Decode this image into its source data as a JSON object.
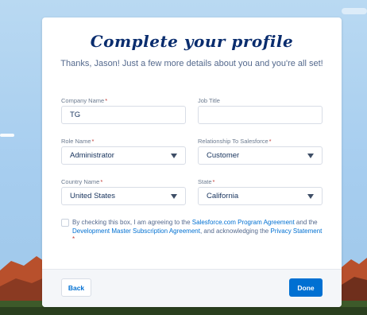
{
  "header": {
    "title": "Complete your profile",
    "subtitle": "Thanks, Jason! Just a few more details about you and you're all set!"
  },
  "form": {
    "company_name": {
      "label": "Company Name",
      "value": "TG",
      "required": "*"
    },
    "job_title": {
      "label": "Job Title",
      "value": ""
    },
    "role_name": {
      "label": "Role Name",
      "value": "Administrator",
      "required": "*"
    },
    "relationship": {
      "label": "Relationship To Salesforce",
      "value": "Customer",
      "required": "*"
    },
    "country_name": {
      "label": "Country Name",
      "value": "United States",
      "required": "*"
    },
    "state": {
      "label": "State",
      "value": "California",
      "required": "*"
    }
  },
  "agreement": {
    "text_1": "By checking this box, I am agreeing to the ",
    "link_1": "Salesforce.com Program Agreement",
    "text_2": " and the ",
    "link_2": "Development Master Subscription Agreement",
    "text_3": ", and acknowledging the ",
    "link_3": "Privacy Statement",
    "required": " *"
  },
  "footer": {
    "back_label": "Back",
    "done_label": "Done"
  },
  "colors": {
    "brand_blue": "#0070d2",
    "title_navy": "#0a2d6e",
    "required_red": "#c23934"
  }
}
